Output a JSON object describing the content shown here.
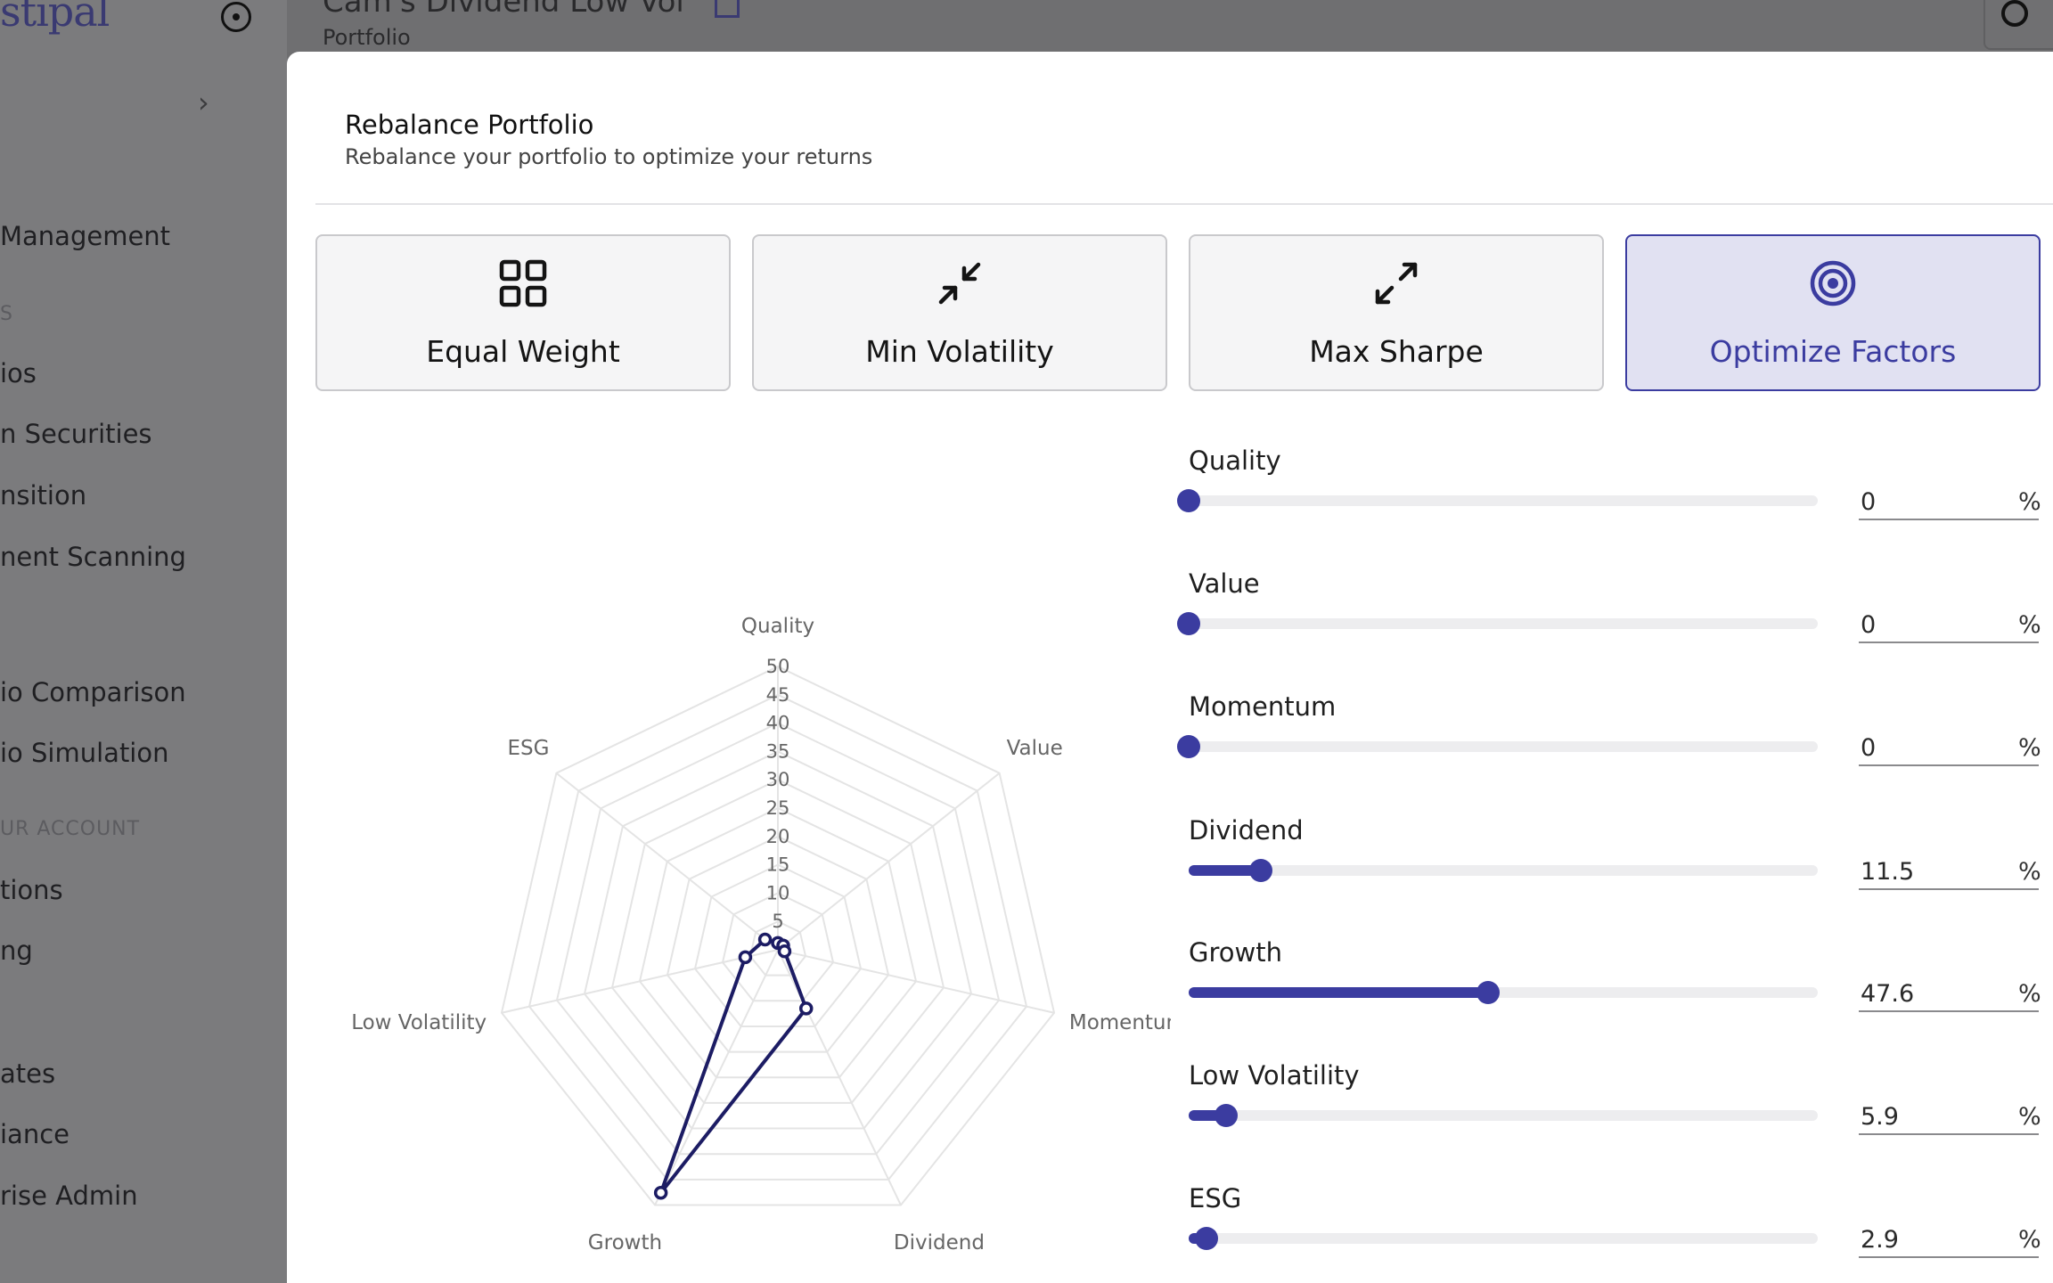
{
  "background": {
    "logo": "stipal",
    "header_title": "Cam's Dividend Low Vol",
    "header_subtitle": "Portfolio",
    "sidebar_items": [
      "Management",
      "ios",
      "n Securities",
      "nsition",
      "nent Scanning",
      "io Comparison",
      "io Simulation",
      "tions",
      "ng",
      "ates",
      "iance",
      "rise Admin"
    ],
    "sidebar_sections": [
      "S",
      "UR ACCOUNT"
    ]
  },
  "modal": {
    "title": "Rebalance Portfolio",
    "subtitle": "Rebalance your portfolio to optimize your returns",
    "strategies": [
      {
        "label": "Equal Weight",
        "icon": "grid-icon",
        "active": false
      },
      {
        "label": "Min Volatility",
        "icon": "arrows-in-icon",
        "active": false
      },
      {
        "label": "Max Sharpe",
        "icon": "arrows-out-icon",
        "active": false
      },
      {
        "label": "Optimize Factors",
        "icon": "target-icon",
        "active": true
      }
    ],
    "factors": [
      {
        "label": "Quality",
        "value": "0",
        "pct": 0
      },
      {
        "label": "Value",
        "value": "0",
        "pct": 0
      },
      {
        "label": "Momentum",
        "value": "0",
        "pct": 0
      },
      {
        "label": "Dividend",
        "value": "11.5",
        "pct": 11.5
      },
      {
        "label": "Growth",
        "value": "47.6",
        "pct": 47.6
      },
      {
        "label": "Low Volatility",
        "value": "5.9",
        "pct": 5.9
      },
      {
        "label": "ESG",
        "value": "2.9",
        "pct": 2.9
      }
    ],
    "percent_symbol": "%"
  },
  "accent_color": "#3b3ca0",
  "chart_data": {
    "type": "radar",
    "axes": [
      "Quality",
      "Value",
      "Momentum",
      "Dividend",
      "Growth",
      "Low Volatility",
      "ESG"
    ],
    "ticks": [
      "5",
      "10",
      "15",
      "20",
      "25",
      "30",
      "35",
      "40",
      "45",
      "50"
    ],
    "range": [
      0,
      50
    ],
    "values": [
      0,
      0,
      0,
      11.5,
      47.6,
      5.9,
      2.9
    ],
    "series_color": "#1c1c64",
    "grid": true
  }
}
